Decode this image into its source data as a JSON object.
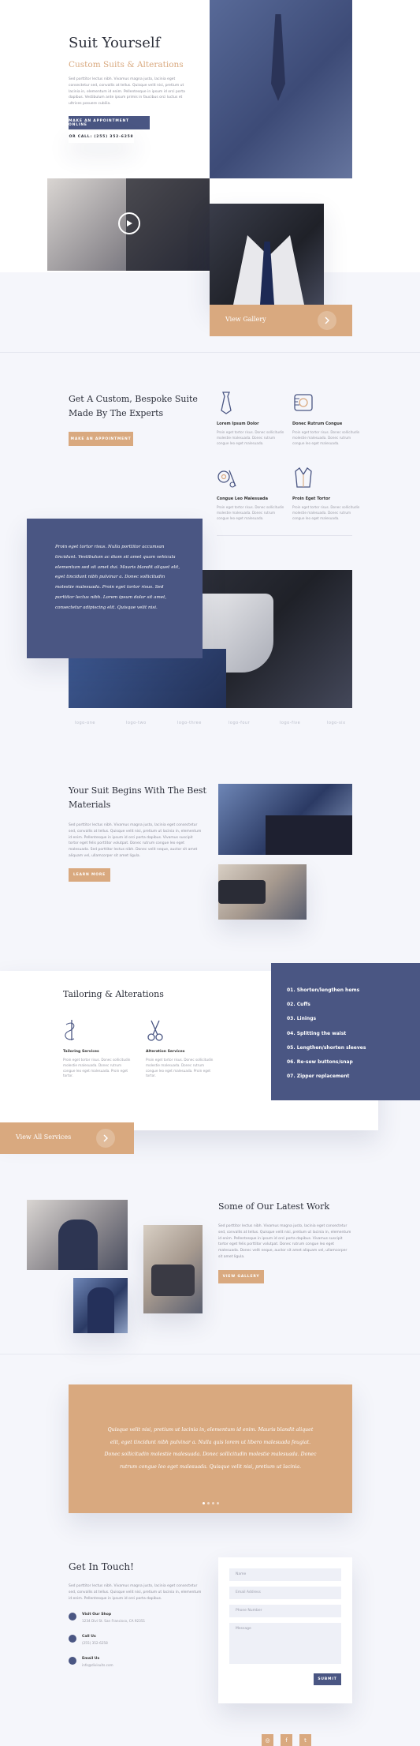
{
  "hero": {
    "title": "Suit Yourself",
    "subtitle": "Custom Suits & Alterations",
    "body": "Sed porttitor lectus nibh. Vivamus magna justo, lacinia eget consectetur sed, convallis at tellus. Quisque velit nisi, pretium ut lacinia in, elementum id enim. Pellentesque in ipsum id orci porta dapibus. Vestibulum ante ipsum primis in faucibus orci luctus et ultrices posuere cubilia.",
    "primary_button": "MAKE AN APPOINTMENT ONLINE",
    "secondary_button": "OR CALL: (255) 352-6258"
  },
  "gallery_cta": {
    "label": "View Gallery"
  },
  "bespoke": {
    "title": "Get A Custom, Bespoke Suite Made By The Experts",
    "button": "MAKE AN APPOINTMENT",
    "features": [
      {
        "icon": "tie-icon",
        "title": "Lorem Ipsum Dolor",
        "text": "Proin eget tortor risus. Donec sollicitudin molestie malesuada. Donec rutrum congue leo eget malesuada."
      },
      {
        "icon": "measuring-tape-icon",
        "title": "Donec Rutrum Congue",
        "text": "Proin eget tortor risus. Donec sollicitudin molestie malesuada. Donec rutrum congue leo eget malesuada."
      },
      {
        "icon": "thread-spool-icon",
        "title": "Congue Leo Malesuada",
        "text": "Proin eget tortor risus. Donec sollicitudin molestie malesuada. Donec rutrum congue leo eget malesuada."
      },
      {
        "icon": "suit-jacket-icon",
        "title": "Proin Eget Tortor",
        "text": "Proin eget tortor risus. Donec sollicitudin molestie malesuada. Donec rutrum congue leo eget malesuada."
      }
    ]
  },
  "quote": {
    "text": "Proin eget tortor risus. Nulla porttitor accumsan tincidunt. Vestibulum ac diam sit amet quam vehicula elementum sed sit amet dui. Mauris blandit aliquet elit, eget tincidunt nibh pulvinar a. Donec sollicitudin molestie malesuada. Proin eget tortor risus. Sed porttitor lectus nibh. Lorem ipsum dolor sit amet, consectetur adipiscing elit. Quisque velit nisi."
  },
  "logos": [
    "logo-one",
    "logo-two",
    "logo-three",
    "logo-four",
    "logo-five",
    "logo-six"
  ],
  "materials": {
    "title": "Your Suit Begins With The Best Materials",
    "body": "Sed porttitor lectus nibh. Vivamus magna justo, lacinia eget consectetur sed, convallis at tellus. Quisque velit nisi, pretium ut lacinia in, elementum id enim. Pellentesque in ipsum id orci porta dapibus. Vivamus suscipit tortor eget felis porttitor volutpat. Donec rutrum congue leo eget malesuada. Sed porttitor lectus nibh. Donec velit neque, auctor sit amet aliquam vel, ullamcorper sit amet ligula.",
    "button": "LEARN MORE"
  },
  "tailoring": {
    "title": "Tailoring & Alterations",
    "services": [
      {
        "icon": "needle-thread-icon",
        "title": "Tailoring Services",
        "text": "Proin eget tortor risus. Donec sollicitudin molestie malesuada. Donec rutrum congue leo eget malesuada. Proin eget tortor."
      },
      {
        "icon": "scissors-icon",
        "title": "Alteration Services",
        "text": "Proin eget tortor risus. Donec sollicitudin molestie malesuada. Donec rutrum congue leo eget malesuada. Proin eget tortor."
      }
    ],
    "list": [
      "01. Shorten/lengthen hems",
      "02. Cuffs",
      "03. Linings",
      "04. Splitting the waist",
      "05. Lengthen/shorten sleeves",
      "06. Re-sew buttons/snap",
      "07. Zipper replacement"
    ],
    "all_services": "View All Services"
  },
  "latest_work": {
    "title": "Some of Our Latest Work",
    "body": "Sed porttitor lectus nibh. Vivamus magna justo, lacinia eget consectetur sed, convallis at tellus. Quisque velit nisi, pretium ut lacinia in, elementum id enim. Pellentesque in ipsum id orci porta dapibus. Vivamus suscipit tortor eget felis porttitor volutpat. Donec rutrum congue leo eget malesuada. Donec velit neque, auctor sit amet aliquam vel, ullamcorper sit amet ligula.",
    "button": "VIEW GALLERY"
  },
  "testimonial": {
    "text": "Quisque velit nisi, pretium ut lacinia in, elementum id enim. Mauris blandit aliquet elit, eget tincidunt nibh pulvinar a. Nulla quis lorem ut libero malesuada feugiat. Donec sollicitudin molestie malesuada. Donec sollicitudin molestie malesuada. Donec rutrum congue leo eget malesuada. Quisque velit nisi, pretium ut lacinia."
  },
  "contact": {
    "title": "Get In Touch!",
    "body": "Sed porttitor lectus nibh. Vivamus magna justo, lacinia eget consectetur sed, convallis at tellus. Quisque velit nisi, pretium ut lacinia in, elementum id enim. Pellentesque in ipsum id orci porta dapibus.",
    "items": [
      {
        "icon": "location-pin-icon",
        "title": "Visit Our Shop",
        "text": "1234 Divi St. San Francisco, CA 92351"
      },
      {
        "icon": "phone-icon",
        "title": "Call Us",
        "text": "(255) 352-6258"
      },
      {
        "icon": "mail-icon",
        "title": "Email Us",
        "text": "info@divisuits.com"
      }
    ],
    "form": {
      "name_placeholder": "Name",
      "email_placeholder": "Email Address",
      "phone_placeholder": "Phone Number",
      "message_placeholder": "Message",
      "submit": "SUBMIT"
    }
  },
  "social": [
    {
      "icon": "instagram-icon",
      "glyph": "◎"
    },
    {
      "icon": "facebook-icon",
      "glyph": "f"
    },
    {
      "icon": "twitter-icon",
      "glyph": "t"
    }
  ],
  "colors": {
    "navy": "#4a5683",
    "tan": "#d9a97f",
    "background": "#f5f6fb"
  }
}
